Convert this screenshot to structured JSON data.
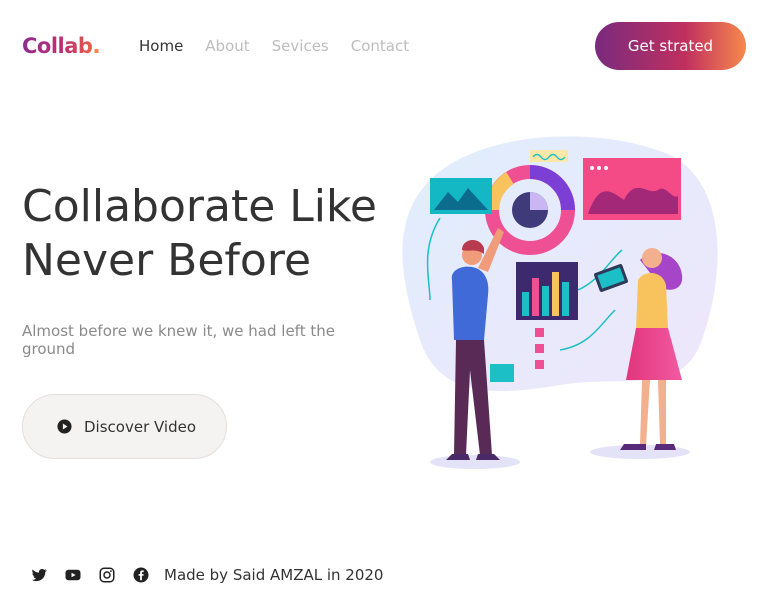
{
  "header": {
    "logo_text": "Collab",
    "logo_dot": ".",
    "nav": [
      {
        "label": "Home",
        "active": true
      },
      {
        "label": "About",
        "active": false
      },
      {
        "label": "Sevices",
        "active": false
      },
      {
        "label": "Contact",
        "active": false
      }
    ],
    "cta_label": "Get strated"
  },
  "hero": {
    "title_line1": "Collaborate Like",
    "title_line2": "Never Before",
    "subtitle": "Almost before we knew it, we had left the ground",
    "video_button_label": "Discover Video"
  },
  "footer": {
    "social_icons": [
      "twitter-icon",
      "youtube-icon",
      "instagram-icon",
      "facebook-icon"
    ],
    "credit": "Made by Said AMZAL in 2020"
  },
  "colors": {
    "brand_gradient_start": "#7a2a7e",
    "brand_gradient_mid": "#c0305f",
    "brand_gradient_end": "#f7894c",
    "nav_active": "#333333",
    "nav_inactive": "#bdbdbd"
  }
}
